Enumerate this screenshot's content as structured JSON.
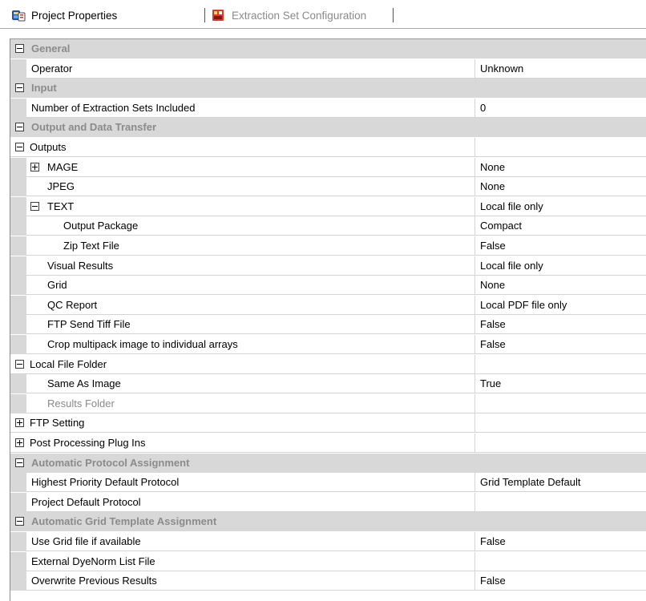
{
  "tabs": [
    {
      "label": "Project Properties",
      "active": true,
      "icon": "project-properties-icon"
    },
    {
      "label": "Extraction Set Configuration",
      "active": false,
      "icon": "extraction-set-icon"
    }
  ],
  "grid": {
    "rows": [
      {
        "type": "category",
        "label": "General",
        "expanded": true
      },
      {
        "type": "prop",
        "label": "Operator",
        "value": "Unknown",
        "indent": 0
      },
      {
        "type": "category",
        "label": "Input",
        "expanded": true
      },
      {
        "type": "prop",
        "label": "Number of Extraction Sets Included",
        "value": "0",
        "indent": 0
      },
      {
        "type": "category",
        "label": "Output and Data Transfer",
        "expanded": true
      },
      {
        "type": "group",
        "label": "Outputs",
        "value": "",
        "expanded": true
      },
      {
        "type": "prop",
        "label": "MAGE",
        "value": "None",
        "indent": 1,
        "toggle": "plus"
      },
      {
        "type": "prop",
        "label": "JPEG",
        "value": "None",
        "indent": 1
      },
      {
        "type": "prop",
        "label": "TEXT",
        "value": "Local file only",
        "indent": 1,
        "toggle": "minus"
      },
      {
        "type": "prop",
        "label": "Output Package",
        "value": "Compact",
        "indent": 2
      },
      {
        "type": "prop",
        "label": "Zip Text File",
        "value": "False",
        "indent": 2
      },
      {
        "type": "prop",
        "label": "Visual Results",
        "value": "Local file only",
        "indent": 1
      },
      {
        "type": "prop",
        "label": "Grid",
        "value": "None",
        "indent": 1
      },
      {
        "type": "prop",
        "label": "QC Report",
        "value": "Local PDF file only",
        "indent": 1
      },
      {
        "type": "prop",
        "label": "FTP Send Tiff File",
        "value": "False",
        "indent": 1
      },
      {
        "type": "prop",
        "label": "Crop multipack image to individual arrays",
        "value": "False",
        "indent": 1
      },
      {
        "type": "group",
        "label": "Local File Folder",
        "value": "",
        "expanded": true
      },
      {
        "type": "prop",
        "label": "Same As Image",
        "value": "True",
        "indent": 1
      },
      {
        "type": "prop",
        "label": "Results Folder",
        "value": "",
        "indent": 1,
        "disabled": true
      },
      {
        "type": "group",
        "label": "FTP Setting",
        "value": "",
        "expanded": false
      },
      {
        "type": "group",
        "label": "Post Processing Plug Ins",
        "value": "",
        "expanded": false
      },
      {
        "type": "category",
        "label": "Automatic Protocol Assignment",
        "expanded": true
      },
      {
        "type": "prop",
        "label": "Highest Priority Default Protocol",
        "value": "Grid Template Default",
        "indent": 0
      },
      {
        "type": "prop",
        "label": "Project Default Protocol",
        "value": "",
        "indent": 0
      },
      {
        "type": "category",
        "label": "Automatic Grid Template Assignment",
        "expanded": true
      },
      {
        "type": "prop",
        "label": "Use Grid file if available",
        "value": "False",
        "indent": 0
      },
      {
        "type": "prop",
        "label": "External DyeNorm List File",
        "value": "",
        "indent": 0
      },
      {
        "type": "prop",
        "label": "Overwrite Previous Results",
        "value": "False",
        "indent": 0
      }
    ]
  }
}
